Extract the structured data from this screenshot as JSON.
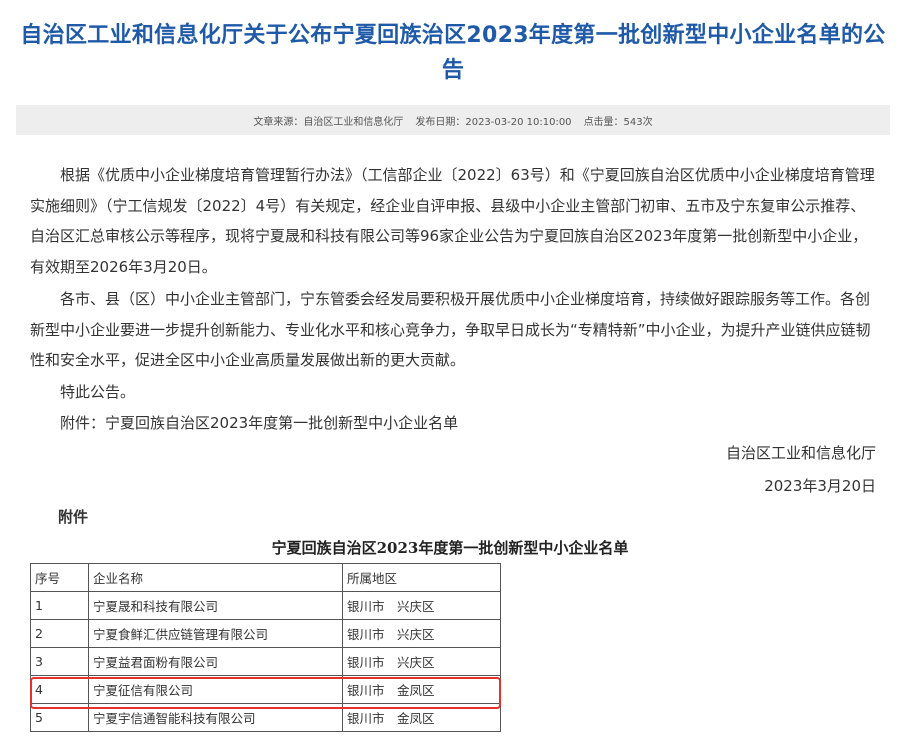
{
  "article": {
    "title": "自治区工业和信息化厅关于公布宁夏回族治区2023年度第一批创新型中小企业名单的公告",
    "meta": {
      "source": "文章来源：自治区工业和信息化厅",
      "date": "发布日期：2023-03-20 10:10:00",
      "hits": "点击量：543次"
    },
    "paragraphs": [
      "根据《优质中小企业梯度培育管理暂行办法》（工信部企业〔2022〕63号）和《宁夏回族自治区优质中小企业梯度培育管理实施细则》（宁工信规发〔2022〕4号）有关规定，经企业自评申报、县级中小企业主管部门初审、五市及宁东复审公示推荐、自治区汇总审核公示等程序，现将宁夏晟和科技有限公司等96家企业公告为宁夏回族自治区2023年度第一批创新型中小企业，有效期至2026年3月20日。",
      "各市、县（区）中小企业主管部门，宁东管委会经发局要积极开展优质中小企业梯度培育，持续做好跟踪服务等工作。各创新型中小企业要进一步提升创新能力、专业化水平和核心竞争力，争取早日成长为“专精特新”中小企业，为提升产业链供应链韧性和安全水平，促进全区中小企业高质量发展做出新的更大贡献。",
      "特此公告。",
      "附件：宁夏回族自治区2023年度第一批创新型中小企业名单"
    ],
    "signature": {
      "org": "自治区工业和信息化厅",
      "date": "2023年3月20日"
    },
    "attachment_heading": "附件",
    "table": {
      "title": "宁夏回族自治区2023年度第一批创新型中小企业名单",
      "headers": [
        "序号",
        "企业名称",
        "所属地区"
      ],
      "rows": [
        [
          "1",
          "宁夏晟和科技有限公司",
          "银川市　兴庆区"
        ],
        [
          "2",
          "宁夏食鲜汇供应链管理有限公司",
          "银川市　兴庆区"
        ],
        [
          "3",
          "宁夏益君面粉有限公司",
          "银川市　兴庆区"
        ],
        [
          "4",
          "宁夏征信有限公司",
          "银川市　金凤区"
        ],
        [
          "5",
          "宁夏宇信通智能科技有限公司",
          "银川市　金凤区"
        ]
      ]
    },
    "highlight_color": "#e5332a",
    "title_color": "#1f5aa8"
  }
}
